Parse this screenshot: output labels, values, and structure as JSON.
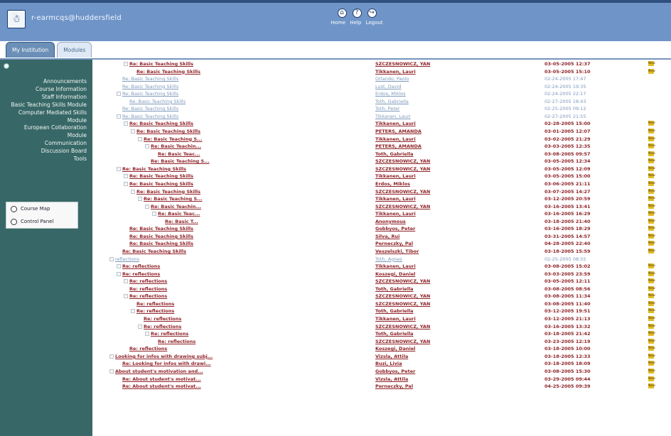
{
  "header": {
    "logo": "☃",
    "user_email": "r-earmcqs@huddersfield",
    "nav": {
      "icons": [
        "home-icon",
        "help-icon",
        "logout-icon"
      ],
      "labels": [
        "Home",
        "Help",
        "Logout"
      ]
    }
  },
  "tabs": [
    {
      "label": "My Institution",
      "active": false
    },
    {
      "label": "Modules",
      "active": true
    }
  ],
  "sidebar": {
    "items": [
      "Announcements",
      "Course Information",
      "Staff Information",
      "Basic Teaching Skills Module",
      "Computer Mediated Skills Module",
      "European Collaboration Module",
      "Communication",
      "Discussion Board",
      "Tools"
    ],
    "tools": [
      "Course Map",
      "Control Panel"
    ]
  },
  "threads": [
    {
      "title": "Re: Basic Teaching Skills",
      "indent": 2,
      "toggle": "-",
      "author": "SZCZESNOWICZ, YAN",
      "date": "03-05-2005 12:37",
      "unread": true,
      "badge": "New"
    },
    {
      "title": "Re: Basic Teaching Skills",
      "indent": 3,
      "toggle": "",
      "author": "Tikkanen, Lauri",
      "date": "03-05-2005 15:10",
      "unread": true,
      "badge": "New"
    },
    {
      "title": "Re: Basic Teaching Skills",
      "indent": 1,
      "toggle": "",
      "author": "Orlando, Paolo",
      "date": "02-24-2005 17:47",
      "unread": false,
      "badge": ""
    },
    {
      "title": "Re: Basic Teaching Skills",
      "indent": 1,
      "toggle": "",
      "author": "Lust, David",
      "date": "02-24-2005 19:35",
      "unread": false,
      "badge": ""
    },
    {
      "title": "Re: Basic Teaching Skills",
      "indent": 1,
      "toggle": "-",
      "author": "Erdos, Miklos",
      "date": "02-24-2005 22:17",
      "unread": false,
      "badge": ""
    },
    {
      "title": "Re: Basic Teaching Skills",
      "indent": 2,
      "toggle": "",
      "author": "Toth, Gabriella",
      "date": "02-27-2005 18:43",
      "unread": false,
      "badge": ""
    },
    {
      "title": "Re: Basic Teaching Skills",
      "indent": 1,
      "toggle": "",
      "author": "Toth, Peter",
      "date": "02-25-2005 09:12",
      "unread": false,
      "badge": ""
    },
    {
      "title": "Re: Basic Teaching Skills",
      "indent": 1,
      "toggle": "-",
      "author": "Tikkanen, Lauri",
      "date": "02-27-2005 21:55",
      "unread": false,
      "badge": ""
    },
    {
      "title": "Re: Basic Teaching Skills",
      "indent": 2,
      "toggle": "-",
      "author": "Tikkanen, Lauri",
      "date": "02-28-2005 15:00",
      "unread": true,
      "badge": "New"
    },
    {
      "title": "Re: Basic Teaching Skills",
      "indent": 3,
      "toggle": "-",
      "author": "PETERS, AMANDA",
      "date": "03-01-2005 12:07",
      "unread": true,
      "badge": "New"
    },
    {
      "title": "Re: Basic Teaching S...",
      "indent": 4,
      "toggle": "-",
      "author": "Tikkanen, Lauri",
      "date": "03-02-2005 21:29",
      "unread": true,
      "badge": "New"
    },
    {
      "title": "Re: Basic Teachin...",
      "indent": 5,
      "toggle": "-",
      "author": "PETERS, AMANDA",
      "date": "03-03-2005 12:35",
      "unread": true,
      "badge": "New"
    },
    {
      "title": "Re: Basic Teac...",
      "indent": 6,
      "toggle": "",
      "author": "Toth, Gabriella",
      "date": "03-08-2005 09:57",
      "unread": true,
      "badge": "New"
    },
    {
      "title": "Re: Basic Teaching S...",
      "indent": 5,
      "toggle": "",
      "author": "SZCZESNOWICZ, YAN",
      "date": "03-05-2005 12:34",
      "unread": true,
      "badge": "New"
    },
    {
      "title": "Re: Basic Teaching Skills",
      "indent": 1,
      "toggle": "-",
      "author": "SZCZESNOWICZ, YAN",
      "date": "03-05-2005 12:09",
      "unread": true,
      "badge": "New"
    },
    {
      "title": "Re: Basic Teaching Skills",
      "indent": 2,
      "toggle": "-",
      "author": "Tikkanen, Lauri",
      "date": "03-05-2005 15:00",
      "unread": true,
      "badge": "New"
    },
    {
      "title": "Re: Basic Teaching Skills",
      "indent": 2,
      "toggle": "-",
      "author": "Erdos, Miklos",
      "date": "03-06-2005 21:11",
      "unread": true,
      "badge": "New"
    },
    {
      "title": "Re: Basic Teaching Skills",
      "indent": 3,
      "toggle": "-",
      "author": "SZCZESNOWICZ, YAN",
      "date": "03-07-2005 14:27",
      "unread": true,
      "badge": "New"
    },
    {
      "title": "Re: Basic Teaching S...",
      "indent": 4,
      "toggle": "-",
      "author": "Tikkanen, Lauri",
      "date": "03-12-2005 20:59",
      "unread": true,
      "badge": "New"
    },
    {
      "title": "Re: Basic Teachin...",
      "indent": 5,
      "toggle": "-",
      "author": "SZCZESNOWICZ, YAN",
      "date": "03-16-2005 13:41",
      "unread": true,
      "badge": "New"
    },
    {
      "title": "Re: Basic Teac...",
      "indent": 6,
      "toggle": "-",
      "author": "Tikkanen, Lauri",
      "date": "03-16-2005 16:29",
      "unread": true,
      "badge": "New"
    },
    {
      "title": "Re: Basic T...",
      "indent": 7,
      "toggle": "",
      "author": "Anonymous",
      "date": "03-18-2005 21:40",
      "unread": true,
      "badge": "New"
    },
    {
      "title": "Re: Basic Teaching Skills",
      "indent": 2,
      "toggle": "",
      "author": "Gobbyos, Peter",
      "date": "03-16-2005 18:29",
      "unread": true,
      "badge": "New"
    },
    {
      "title": "Re: Basic Teaching Skills",
      "indent": 2,
      "toggle": "",
      "author": "Silva, Rui",
      "date": "03-31-2005 14:57",
      "unread": true,
      "badge": "New"
    },
    {
      "title": "Re: Basic Teaching Skills",
      "indent": 2,
      "toggle": "",
      "author": "Perneczky, Pal",
      "date": "04-28-2005 22:40",
      "unread": true,
      "badge": "New"
    },
    {
      "title": "Re: Basic Teaching Skills",
      "indent": 1,
      "toggle": "",
      "author": "Veszelszki, Tibor",
      "date": "03-18-2005 15:59",
      "unread": true,
      "badge": "New"
    },
    {
      "title": "reflections",
      "indent": 0,
      "toggle": "-",
      "author": "Toth, Agnes",
      "date": "02-25-2005 08:55",
      "unread": false,
      "badge": ""
    },
    {
      "title": "Re: reflections",
      "indent": 1,
      "toggle": "-",
      "author": "Tikkanen, Lauri",
      "date": "03-08-2005 15:02",
      "unread": true,
      "badge": "New"
    },
    {
      "title": "Re: reflections",
      "indent": 1,
      "toggle": "-",
      "author": "Koszegi, Daniel",
      "date": "03-03-2005 23:59",
      "unread": true,
      "badge": "New"
    },
    {
      "title": "Re: reflections",
      "indent": 2,
      "toggle": "-",
      "author": "SZCZESNOWICZ, YAN",
      "date": "03-05-2005 12:11",
      "unread": true,
      "badge": "New"
    },
    {
      "title": "Re: reflections",
      "indent": 2,
      "toggle": "",
      "author": "Toth, Gabriella",
      "date": "03-08-2005 08:56",
      "unread": true,
      "badge": "New"
    },
    {
      "title": "Re: reflections",
      "indent": 2,
      "toggle": "-",
      "author": "SZCZESNOWICZ, YAN",
      "date": "03-08-2005 11:34",
      "unread": true,
      "badge": "New"
    },
    {
      "title": "Re: reflections",
      "indent": 3,
      "toggle": "",
      "author": "SZCZESNOWICZ, YAN",
      "date": "03-08-2005 11:40",
      "unread": true,
      "badge": "New"
    },
    {
      "title": "Re: reflections",
      "indent": 3,
      "toggle": "-",
      "author": "Toth, Gabriella",
      "date": "03-12-2005 19:51",
      "unread": true,
      "badge": "New"
    },
    {
      "title": "Re: reflections",
      "indent": 4,
      "toggle": "",
      "author": "Tikkanen, Lauri",
      "date": "03-12-2005 21:13",
      "unread": true,
      "badge": "New"
    },
    {
      "title": "Re: reflections",
      "indent": 4,
      "toggle": "-",
      "author": "SZCZESNOWICZ, YAN",
      "date": "03-16-2005 13:32",
      "unread": true,
      "badge": "New"
    },
    {
      "title": "Re: reflections",
      "indent": 5,
      "toggle": "-",
      "author": "Toth, Gabriella",
      "date": "03-18-2005 21:42",
      "unread": true,
      "badge": "New"
    },
    {
      "title": "Re: reflections",
      "indent": 6,
      "toggle": "",
      "author": "SZCZESNOWICZ, YAN",
      "date": "03-23-2005 12:19",
      "unread": true,
      "badge": "New"
    },
    {
      "title": "Re: reflections",
      "indent": 2,
      "toggle": "",
      "author": "Koszegi, Daniel",
      "date": "03-18-2005 10:00",
      "unread": true,
      "badge": "New"
    },
    {
      "title": "Looking for infos with drawing subj...",
      "indent": 0,
      "toggle": "-",
      "author": "Vizsla, Attila",
      "date": "03-18-2005 12:33",
      "unread": true,
      "badge": "New"
    },
    {
      "title": "Re: Looking for infos with drawi...",
      "indent": 1,
      "toggle": "",
      "author": "Buzi, Livia",
      "date": "03-18-2005 18:09",
      "unread": true,
      "badge": "New"
    },
    {
      "title": "About student's motivation and...",
      "indent": 0,
      "toggle": "-",
      "author": "Gobbyos, Peter",
      "date": "03-08-2005 15:30",
      "unread": true,
      "badge": "New"
    },
    {
      "title": "Re: About student's motivat...",
      "indent": 1,
      "toggle": "",
      "author": "Vizsla, Attila",
      "date": "03-29-2005 09:44",
      "unread": true,
      "badge": "New"
    },
    {
      "title": "Re: About student's motivat...",
      "indent": 1,
      "toggle": "",
      "author": "Perneczky, Pal",
      "date": "04-25-2005 09:39",
      "unread": true,
      "badge": "New"
    }
  ]
}
